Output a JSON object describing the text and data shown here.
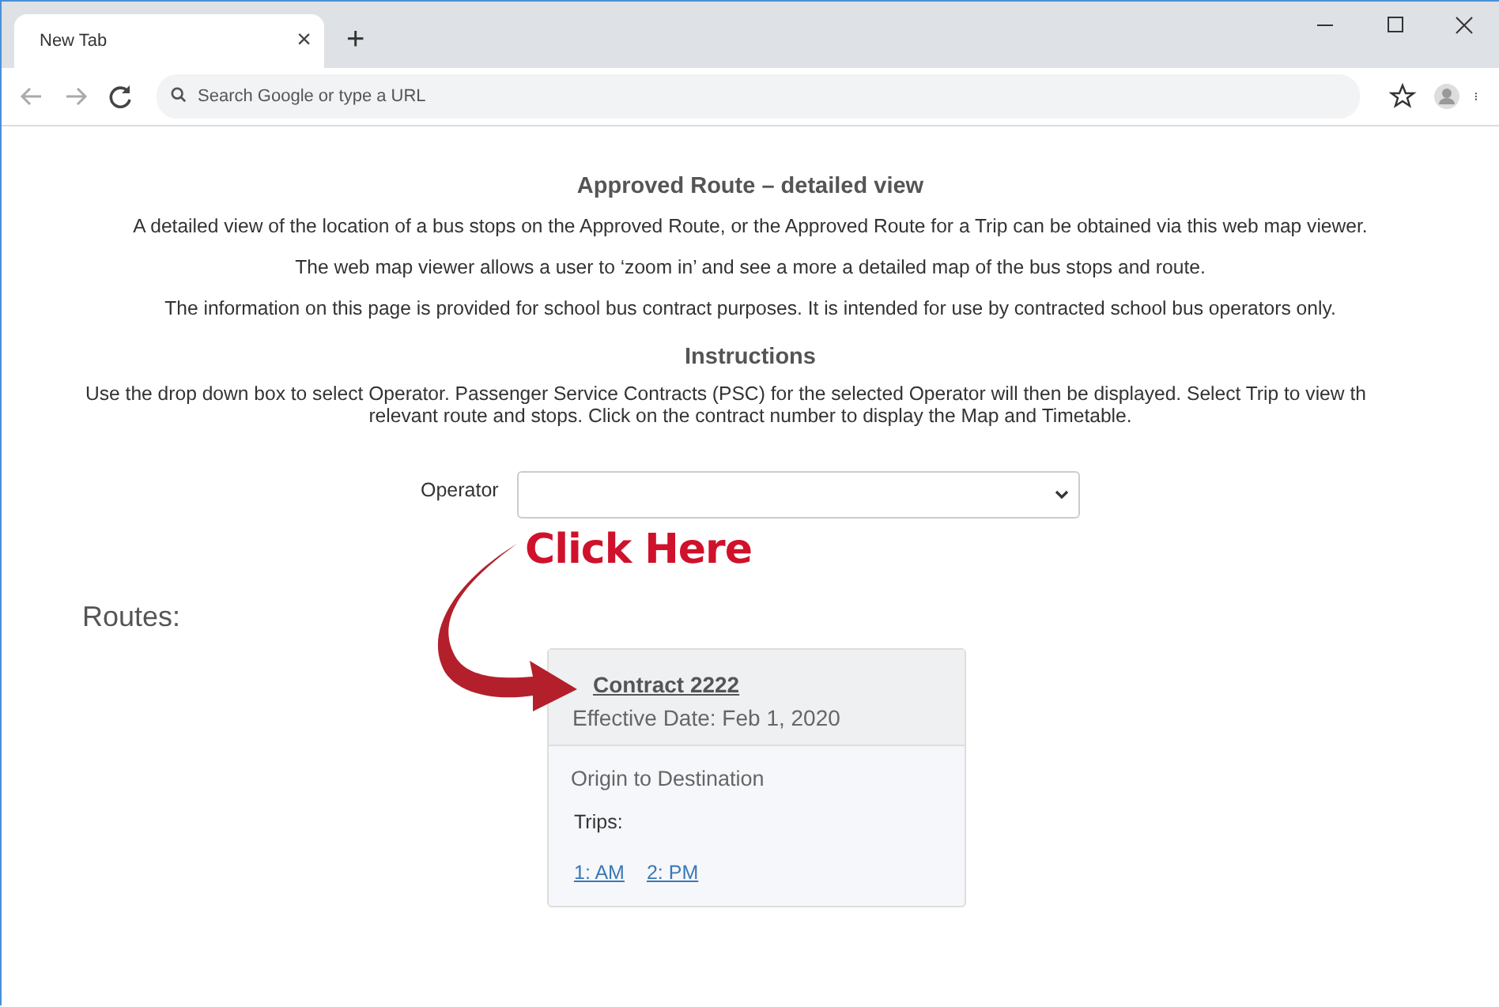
{
  "browser": {
    "tab": {
      "title": "New Tab",
      "selected": true
    },
    "close_tab": "×",
    "new_tab": "+",
    "address": {
      "placeholder": "Search Google or type a URL"
    }
  },
  "page": {
    "title": "Approved Route – detailed view",
    "paragraphs": [
      "A detailed view of the location of a bus stops on the Approved Route, or the Approved Route for a Trip can be obtained via this web map viewer.",
      "The web map viewer allows a user to ‘zoom in’ and see a more a detailed map of the bus stops and route.",
      "The information on this page is provided for school bus contract purposes. It is intended for use by contracted school bus operators only."
    ],
    "instructions_heading": "Instructions",
    "instructions_lines": [
      "Use the drop down box to select Operator. Passenger Service Contracts (PSC) for the selected Operator will then be displayed. Select Trip to view th",
      "relevant route and stops. Click on the contract number to display the Map and Timetable."
    ],
    "operator": {
      "label": "Operator"
    },
    "callout": "Click Here",
    "routes_heading": "Routes:",
    "contract": {
      "link": "Contract 2222",
      "effective_date": "Effective Date: Feb 1, 2020",
      "origin": "Origin",
      "to": "to",
      "destination": "Destination",
      "trips_label": "Trips:",
      "trips": [
        "1: AM",
        "2: PM"
      ]
    }
  }
}
